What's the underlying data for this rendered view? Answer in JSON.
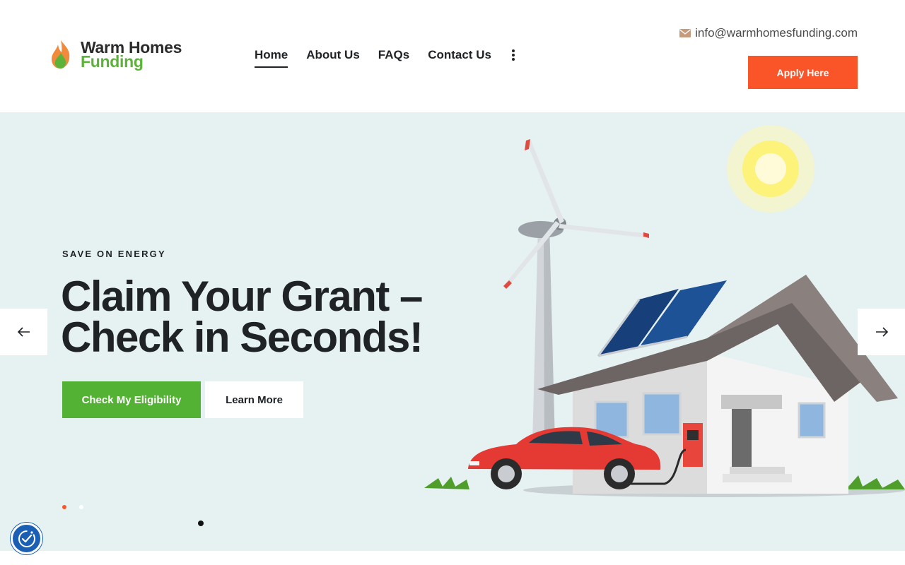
{
  "brand": {
    "name_line1": "Warm Homes",
    "name_line2": "Funding",
    "flame_orange": "#f08a3c",
    "flame_green": "#5db33a"
  },
  "nav": {
    "items": [
      {
        "label": "Home",
        "active": true
      },
      {
        "label": "About Us",
        "active": false
      },
      {
        "label": "FAQs",
        "active": false
      },
      {
        "label": "Contact Us",
        "active": false
      }
    ],
    "more_icon": "vertical-dots-icon"
  },
  "contact": {
    "email": "info@warmhomesfunding.com",
    "icon": "envelope-icon"
  },
  "header_cta": {
    "label": "Apply Here",
    "color": "#fa5528"
  },
  "hero": {
    "eyebrow": "SAVE ON ENERGY",
    "headline_line1": "Claim Your Grant –",
    "headline_line2": "Check in Seconds!",
    "primary_button": "Check My Eligibility",
    "secondary_button": "Learn More",
    "primary_color": "#53b133",
    "background": "#e6f1f2",
    "prev_icon": "arrow-left-icon",
    "next_icon": "arrow-right-icon",
    "slides_count": 2,
    "active_slide": 1
  },
  "consent": {
    "icon": "cookie-consent-icon"
  }
}
